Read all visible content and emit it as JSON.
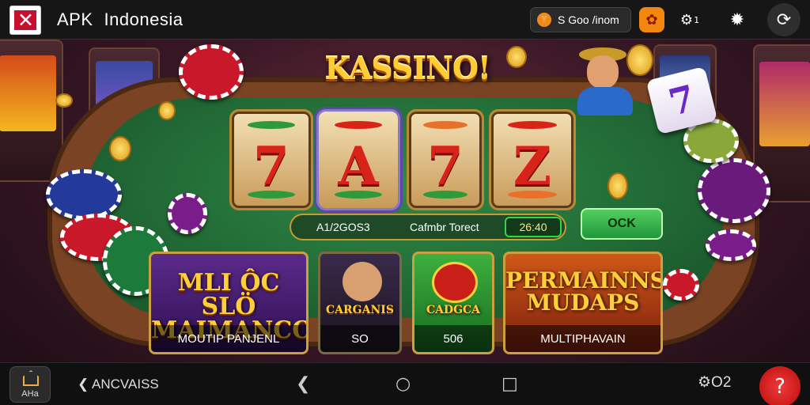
{
  "header": {
    "brand_apk": "APK",
    "brand_country": "Indonesia",
    "balance_label": "S Goo /inom",
    "gear_badge": "1"
  },
  "game": {
    "title": "KASSINO!",
    "reels": [
      "7",
      "A",
      "7",
      "Z"
    ],
    "info_left": "A1/2GOS3",
    "info_center": "Cafmbr Torect",
    "info_right": "26:40",
    "ok_label": "OCK"
  },
  "cards": [
    {
      "name": "MLI ÔC SLÖ\nMAIMANCO",
      "caption": "MOUTIP PANJENL"
    },
    {
      "name": "CARGANIS",
      "caption": "SO"
    },
    {
      "name": "CADGCA",
      "caption": "506"
    },
    {
      "name": "PERMAINNS\nMUDAPS",
      "caption": "MULTIPHAVAIN"
    }
  ],
  "nav": {
    "home_label": "AHa",
    "back_label": "ANCVAISS",
    "round_label": "O2"
  },
  "colors": {
    "felt": "#2f8a48",
    "gold": "#ffcc33",
    "accent_red": "#d82418"
  },
  "icons": [
    "app-logo-icon",
    "coin-icon",
    "gift-icon",
    "gear-icon",
    "puzzle-icon",
    "settings-icon",
    "home-icon",
    "back-icon",
    "circle-home-icon",
    "square-recent-icon",
    "help-icon"
  ]
}
